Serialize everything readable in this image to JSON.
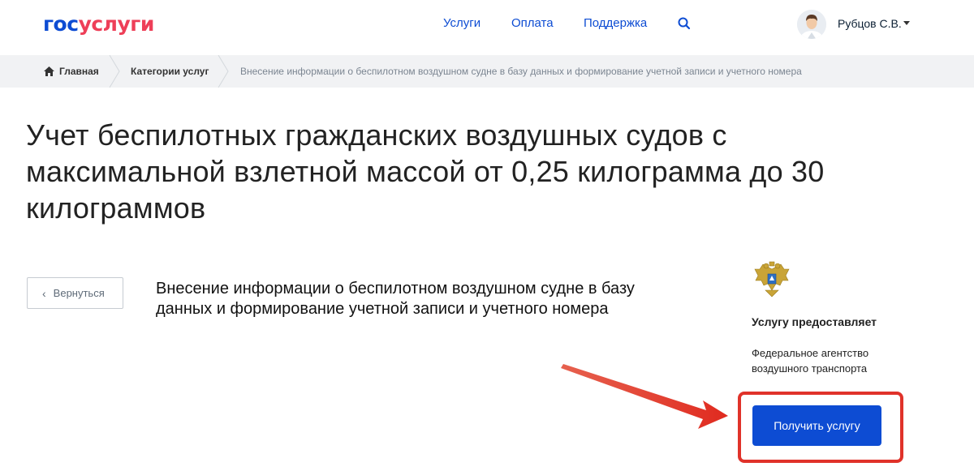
{
  "header": {
    "logo_part1": "гос",
    "logo_part2": "услуги",
    "nav": [
      "Услуги",
      "Оплата",
      "Поддержка"
    ],
    "user_name": "Рубцов С.В."
  },
  "breadcrumb": {
    "home": "Главная",
    "categories": "Категории услуг",
    "current": "Внесение информации о беспилотном воздушном судне в базу данных и формирование учетной записи и учетного номера"
  },
  "page": {
    "title": "Учет беспилотных гражданских воздушных судов с максимальной взлетной массой от 0,25 килограмма до 30 килограммов",
    "back_label": "Вернуться",
    "service_title": "Внесение информации о беспилотном воздушном судне в базу данных и формирование учетной записи и учетного номера"
  },
  "provider": {
    "label": "Услугу предоставляет",
    "name": "Федеральное агентство воздушного транспорта",
    "cta_label": "Получить услугу"
  },
  "colors": {
    "brand_blue": "#0d4cd3",
    "brand_red": "#ee3f58",
    "annotation_red": "#e0322a"
  },
  "icons": [
    "search-icon",
    "home-icon",
    "chevron-left-icon",
    "caret-down-icon",
    "emblem-icon",
    "arrow-annotation"
  ]
}
